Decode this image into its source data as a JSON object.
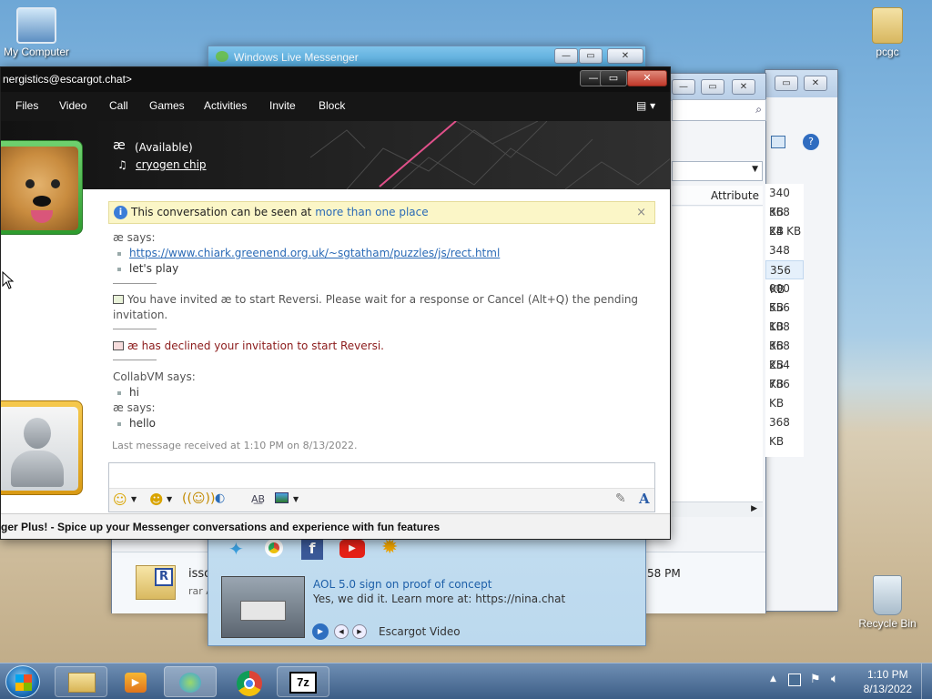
{
  "desktop": {
    "icons": [
      {
        "label": "My Computer"
      },
      {
        "label": "pcgc"
      },
      {
        "label": "Recycle Bin"
      }
    ]
  },
  "messenger_main": {
    "title": "Windows Live Messenger",
    "video": {
      "title": "AOL 5.0 sign on proof of concept",
      "subtitle": "Yes, we did it. Learn more at: https://nina.chat",
      "channel": "Escargot Video"
    }
  },
  "explorer": {
    "column_header": "Attribute",
    "sizes": [
      "340 KB",
      "368 KB",
      "24 KB",
      "348 KB",
      "356 KB",
      "000 KB",
      "556 KB",
      "108 KB",
      "368 KB",
      "254 KB",
      "786 KB",
      "368 KB"
    ],
    "bottom_item_name": "isso",
    "bottom_item_sub": "rar A",
    "bottom_item_time": "58 PM"
  },
  "conversation": {
    "title": "nergistics@escargot.chat>",
    "menu": [
      "Files",
      "Video",
      "Call",
      "Games",
      "Activities",
      "Invite",
      "Block"
    ],
    "contact_name": "æ",
    "contact_status": "(Available)",
    "contact_song": "cryogen chip",
    "info_bar_text": "This conversation can be seen at ",
    "info_bar_link": "more than one place",
    "messages": {
      "s1_sender": "æ says:",
      "s1_link": "https://www.chiark.greenend.org.uk/~sgtatham/puzzles/js/rect.html",
      "s1_line2": "let's play",
      "invite_notice": "You have invited æ to start Reversi. Please wait for a response or Cancel (Alt+Q) the pending",
      "invite_notice_2": "invitation.",
      "declined_notice": "æ has declined your invitation to start Reversi.",
      "s2_sender": "CollabVM says:",
      "s2_line": "hi",
      "s3_sender": "æ says:",
      "s3_line": "hello"
    },
    "last_message": "Last message received at 1:10 PM on 8/13/2022.",
    "ad_text": "ger Plus! - Spice up your Messenger conversations and experience with fun features"
  },
  "taskbar": {
    "time": "1:10 PM",
    "date": "8/13/2022"
  },
  "colors": {
    "accent": "#2a6ab6",
    "declined": "#8b1a1a",
    "info_bar": "#fbf6c7"
  }
}
